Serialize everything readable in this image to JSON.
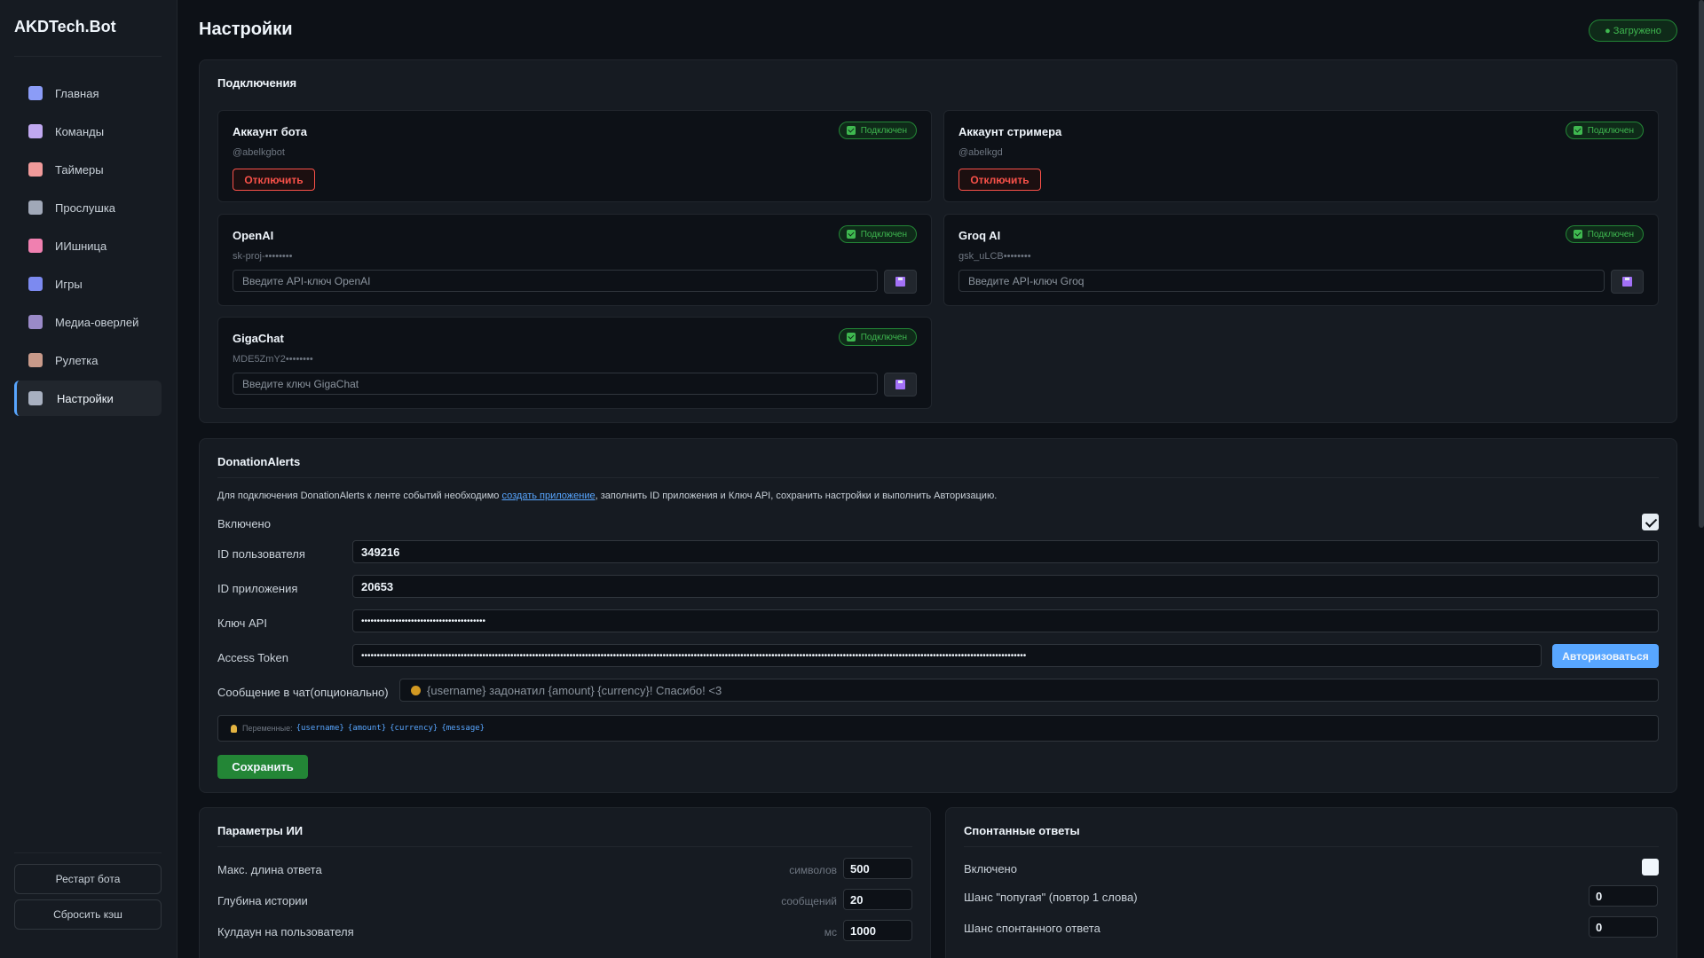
{
  "app": {
    "brand": "AKDTech.Bot"
  },
  "sidebar": {
    "items": [
      {
        "label": "Главная",
        "icon": "chart-icon",
        "color": "#8b9cf7"
      },
      {
        "label": "Команды",
        "icon": "robot-icon",
        "color": "#c0a8f0"
      },
      {
        "label": "Таймеры",
        "icon": "alarm-clock-icon",
        "color": "#f09a9a"
      },
      {
        "label": "Прослушка",
        "icon": "microphone-icon",
        "color": "#a0a8b8"
      },
      {
        "label": "ИИшница",
        "icon": "brain-icon",
        "color": "#f080b0"
      },
      {
        "label": "Игры",
        "icon": "gamepad-icon",
        "color": "#7c8af0"
      },
      {
        "label": "Медиа-оверлей",
        "icon": "clapperboard-icon",
        "color": "#9a8ac8"
      },
      {
        "label": "Рулетка",
        "icon": "wheel-icon",
        "color": "#c89a8a"
      },
      {
        "label": "Настройки",
        "icon": "gear-icon",
        "color": "#a8b0c0",
        "active": true
      }
    ],
    "restart_label": "Рестарт бота",
    "clear_cache_label": "Сбросить кэш"
  },
  "header": {
    "title": "Настройки",
    "status": "● Загружено"
  },
  "connections": {
    "title": "Подключения",
    "connected_label": "Подключен",
    "disconnect_label": "Отключить",
    "bot": {
      "title": "Аккаунт бота",
      "account": "@abelkgbot"
    },
    "streamer": {
      "title": "Аккаунт стримера",
      "account": "@abelkgd"
    },
    "openai": {
      "title": "OpenAI",
      "masked_key": "sk-proj-••••••••",
      "placeholder": "Введите API-ключ OpenAI"
    },
    "groq": {
      "title": "Groq AI",
      "masked_key": "gsk_uLCB••••••••",
      "placeholder": "Введите API-ключ Groq"
    },
    "gigachat": {
      "title": "GigaChat",
      "masked_key": "MDE5ZmY2••••••••",
      "placeholder": "Введите ключ GigaChat"
    }
  },
  "donation": {
    "title": "DonationAlerts",
    "desc_before": "Для подключения DonationAlerts к ленте событий необходимо ",
    "desc_link": "создать приложение",
    "desc_after": ", заполнить ID приложения и Ключ API, сохранить настройки и выполнить Авторизацию.",
    "enabled_label": "Включено",
    "enabled": true,
    "user_id_label": "ID пользователя",
    "user_id": "349216",
    "app_id_label": "ID приложения",
    "app_id": "20653",
    "api_key_label": "Ключ API",
    "api_key": "••••••••••••••••••••••••••••••••••••••••",
    "token_label": "Access Token",
    "token": "••••••••••••••••••••••••••••••••••••••••••••••••••••••••••••••••••••••••••••••••••••••••••••••••••••••••••••••••••••••••••••••••••••••••••••••••••••••••••••••••••••••••••••••••••••••••••••••••••••••••••••••••••••••",
    "authorize_label": "Авторизоваться",
    "chat_msg_label": "Сообщение в чат(опционально)",
    "chat_msg_placeholder": "{username} задонатил {amount} {currency}! Спасибо! <3",
    "vars_label": "Переменные:",
    "vars": [
      "{username}",
      "{amount}",
      "{currency}",
      "{message}"
    ],
    "save_label": "Сохранить"
  },
  "ai_params": {
    "title": "Параметры ИИ",
    "rows": [
      {
        "label": "Макс. длина ответа",
        "unit": "символов",
        "value": "500"
      },
      {
        "label": "Глубина истории",
        "unit": "сообщений",
        "value": "20"
      },
      {
        "label": "Кулдаун на пользователя",
        "unit": "мс",
        "value": "1000"
      }
    ]
  },
  "spontaneous": {
    "title": "Спонтанные ответы",
    "enabled_label": "Включено",
    "enabled": false,
    "rows": [
      {
        "label": "Шанс \"попугая\" (повтор 1 слова)",
        "value": "0"
      },
      {
        "label": "Шанс спонтанного ответа",
        "value": "0"
      }
    ]
  }
}
